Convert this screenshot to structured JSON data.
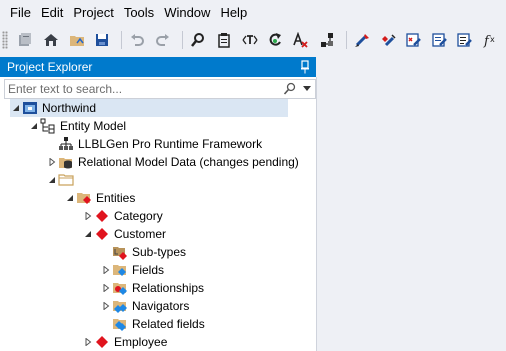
{
  "menu": [
    "File",
    "Edit",
    "Project",
    "Tools",
    "Window",
    "Help"
  ],
  "toolbar": {
    "icons": [
      "new-project-icon",
      "open-project-icon",
      "home-icon",
      "save-icon",
      "undo-icon",
      "redo-icon",
      "find-icon",
      "clipboard-icon",
      "rename-icon",
      "refresh-icon",
      "text-style-icon",
      "relations-icon",
      "designer-icon",
      "edit-entity-icon",
      "edit-model-icon",
      "edit-doc-icon",
      "function-icon"
    ]
  },
  "explorer": {
    "title": "Project Explorer",
    "search_placeholder": "Enter text to search..."
  },
  "tree": [
    {
      "label": "Northwind",
      "icon": "project-icon",
      "expander": "expanded",
      "selected": true
    },
    {
      "label": "Entity Model",
      "icon": "entity-model-icon",
      "expander": "expanded"
    },
    {
      "label": "LLBLGen Pro Runtime Framework",
      "icon": "framework-icon",
      "expander": "none"
    },
    {
      "label": "Relational Model Data (changes pending)",
      "icon": "relational-data-icon",
      "expander": "collapsed"
    },
    {
      "label": "",
      "icon": "folder-icon",
      "expander": "expanded"
    },
    {
      "label": "Entities",
      "icon": "entities-folder-icon",
      "expander": "expanded"
    },
    {
      "label": "Category",
      "icon": "entity-icon",
      "expander": "collapsed"
    },
    {
      "label": "Customer",
      "icon": "entity-icon",
      "expander": "expanded"
    },
    {
      "label": "Sub-types",
      "icon": "subtypes-icon",
      "expander": "none"
    },
    {
      "label": "Fields",
      "icon": "fields-folder-icon",
      "expander": "collapsed"
    },
    {
      "label": "Relationships",
      "icon": "relationships-folder-icon",
      "expander": "collapsed"
    },
    {
      "label": "Navigators",
      "icon": "navigators-folder-icon",
      "expander": "collapsed"
    },
    {
      "label": "Related fields",
      "icon": "related-fields-icon",
      "expander": "none"
    },
    {
      "label": "Employee",
      "icon": "entity-icon",
      "expander": "collapsed"
    }
  ]
}
